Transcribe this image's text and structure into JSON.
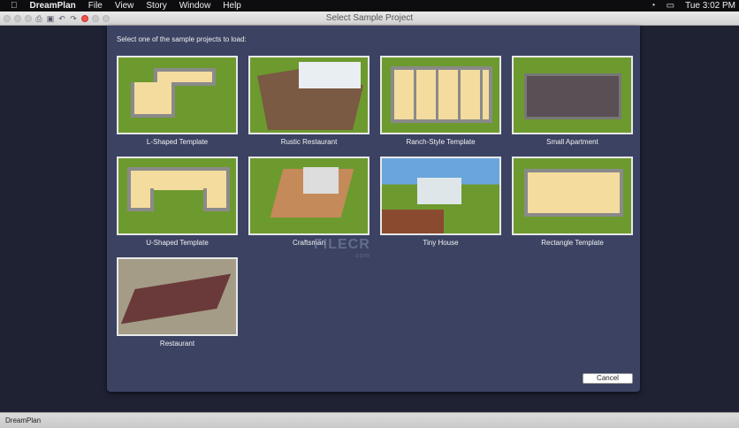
{
  "menubar": {
    "app": "DreamPlan",
    "items": [
      "File",
      "View",
      "Story",
      "Window",
      "Help"
    ],
    "clock": "Tue 3:02 PM"
  },
  "window": {
    "title": "Select Sample Project"
  },
  "dialog": {
    "prompt": "Select one of the sample projects to load:",
    "cancel_label": "Cancel",
    "projects": [
      {
        "label": "L-Shaped Template"
      },
      {
        "label": "Rustic Restaurant"
      },
      {
        "label": "Ranch-Style Template"
      },
      {
        "label": "Small Apartment"
      },
      {
        "label": "U-Shaped Template"
      },
      {
        "label": "Craftsman"
      },
      {
        "label": "Tiny House"
      },
      {
        "label": "Rectangle Template"
      },
      {
        "label": "Restaurant"
      }
    ]
  },
  "watermark": {
    "text": "FILECR",
    "sub": ".com"
  },
  "statusbar": {
    "text": "DreamPlan"
  }
}
